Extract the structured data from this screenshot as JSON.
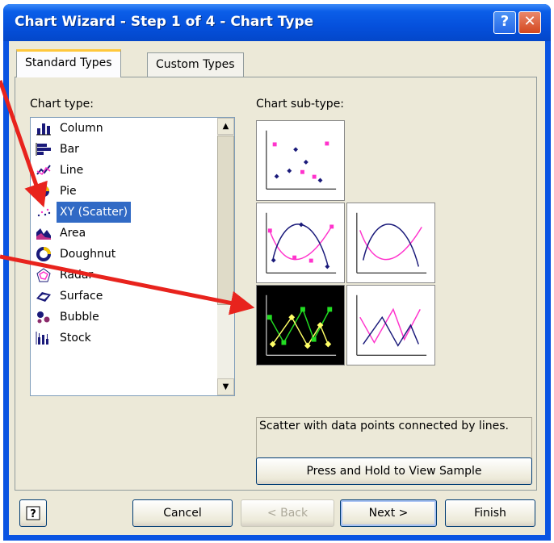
{
  "window": {
    "title": "Chart Wizard - Step 1 of 4 - Chart Type",
    "help_glyph": "?",
    "close_glyph": "✕"
  },
  "tabs": [
    {
      "label": "Standard Types",
      "active": true
    },
    {
      "label": "Custom Types",
      "active": false
    }
  ],
  "chart_type_label": "Chart type:",
  "chart_types": [
    {
      "label": "Column",
      "icon": "column-chart-icon"
    },
    {
      "label": "Bar",
      "icon": "bar-chart-icon"
    },
    {
      "label": "Line",
      "icon": "line-chart-icon"
    },
    {
      "label": "Pie",
      "icon": "pie-chart-icon"
    },
    {
      "label": "XY (Scatter)",
      "icon": "scatter-chart-icon",
      "selected": true
    },
    {
      "label": "Area",
      "icon": "area-chart-icon"
    },
    {
      "label": "Doughnut",
      "icon": "doughnut-chart-icon"
    },
    {
      "label": "Radar",
      "icon": "radar-chart-icon"
    },
    {
      "label": "Surface",
      "icon": "surface-chart-icon"
    },
    {
      "label": "Bubble",
      "icon": "bubble-chart-icon"
    },
    {
      "label": "Stock",
      "icon": "stock-chart-icon"
    }
  ],
  "sub_type_label": "Chart sub-type:",
  "description": "Scatter with data points connected by lines.",
  "buttons": {
    "press_hold": "Press and Hold to View Sample",
    "cancel": "Cancel",
    "back": "< Back",
    "next": "Next >",
    "finish": "Finish"
  },
  "colors": {
    "selection": "#316ac5",
    "arrow": "#e8231d",
    "magenta": "#ff33cc",
    "navy": "#1a1a7a"
  }
}
